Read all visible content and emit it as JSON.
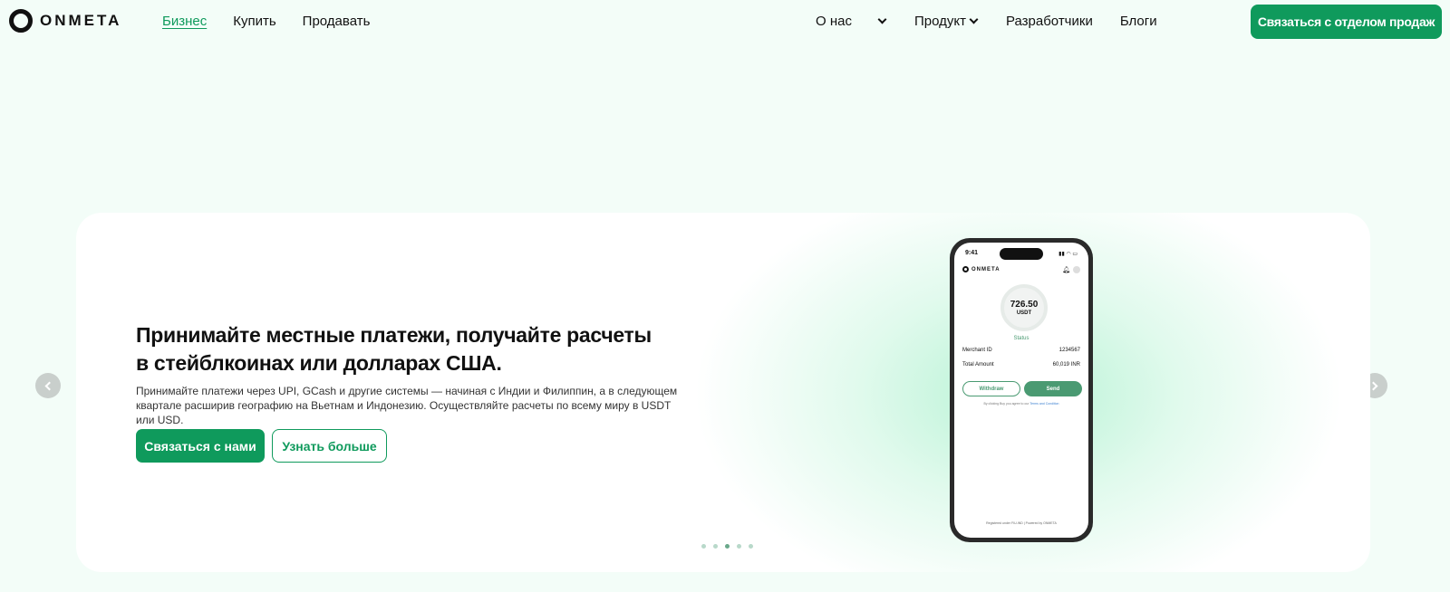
{
  "header": {
    "logo_text": "ONMETA",
    "nav_left": [
      {
        "label": "Бизнес",
        "active": true
      },
      {
        "label": "Купить",
        "active": false
      },
      {
        "label": "Продавать",
        "active": false
      }
    ],
    "nav_right": [
      {
        "label": "О нас",
        "has_dropdown": true
      },
      {
        "label": "Продукт",
        "has_dropdown": true
      },
      {
        "label": "Разработчики",
        "has_dropdown": false
      },
      {
        "label": "Блоги",
        "has_dropdown": false
      }
    ],
    "cta_label": "Связаться с отделом продаж"
  },
  "hero": {
    "title": "Принимайте местные платежи, получайте расчеты в стейблкоинах или долларах США.",
    "subtitle": "Принимайте платежи через UPI, GCash и другие системы — начиная с Индии и Филиппин, а в следующем квартале расширив географию на Вьетнам и Индонезию. Осуществляйте расчеты по всему миру в USDT или USD.",
    "primary_button": "Связаться с нами",
    "secondary_button": "Узнать больше",
    "carousel_dots": 5,
    "active_dot": 2
  },
  "phone": {
    "time": "9:41",
    "logo_text": "ONMETA",
    "balance_amount": "726.50",
    "balance_currency": "USDT",
    "status_label": "Status",
    "merchant_id_label": "Merchant ID",
    "merchant_id_value": "1234567",
    "total_amount_label": "Total Amount",
    "total_amount_value": "60,019 INR",
    "withdraw_label": "Withdraw",
    "send_label": "Send",
    "terms_text": "By clicking Buy you agree to our",
    "terms_link": "Terms and Condition",
    "footer_text": "Registered under FIU-IND | Powered by ONMETA"
  },
  "colors": {
    "brand_green": "#0f9a5c",
    "phone_green": "#4a9a72",
    "background": "#f3fdf8"
  }
}
